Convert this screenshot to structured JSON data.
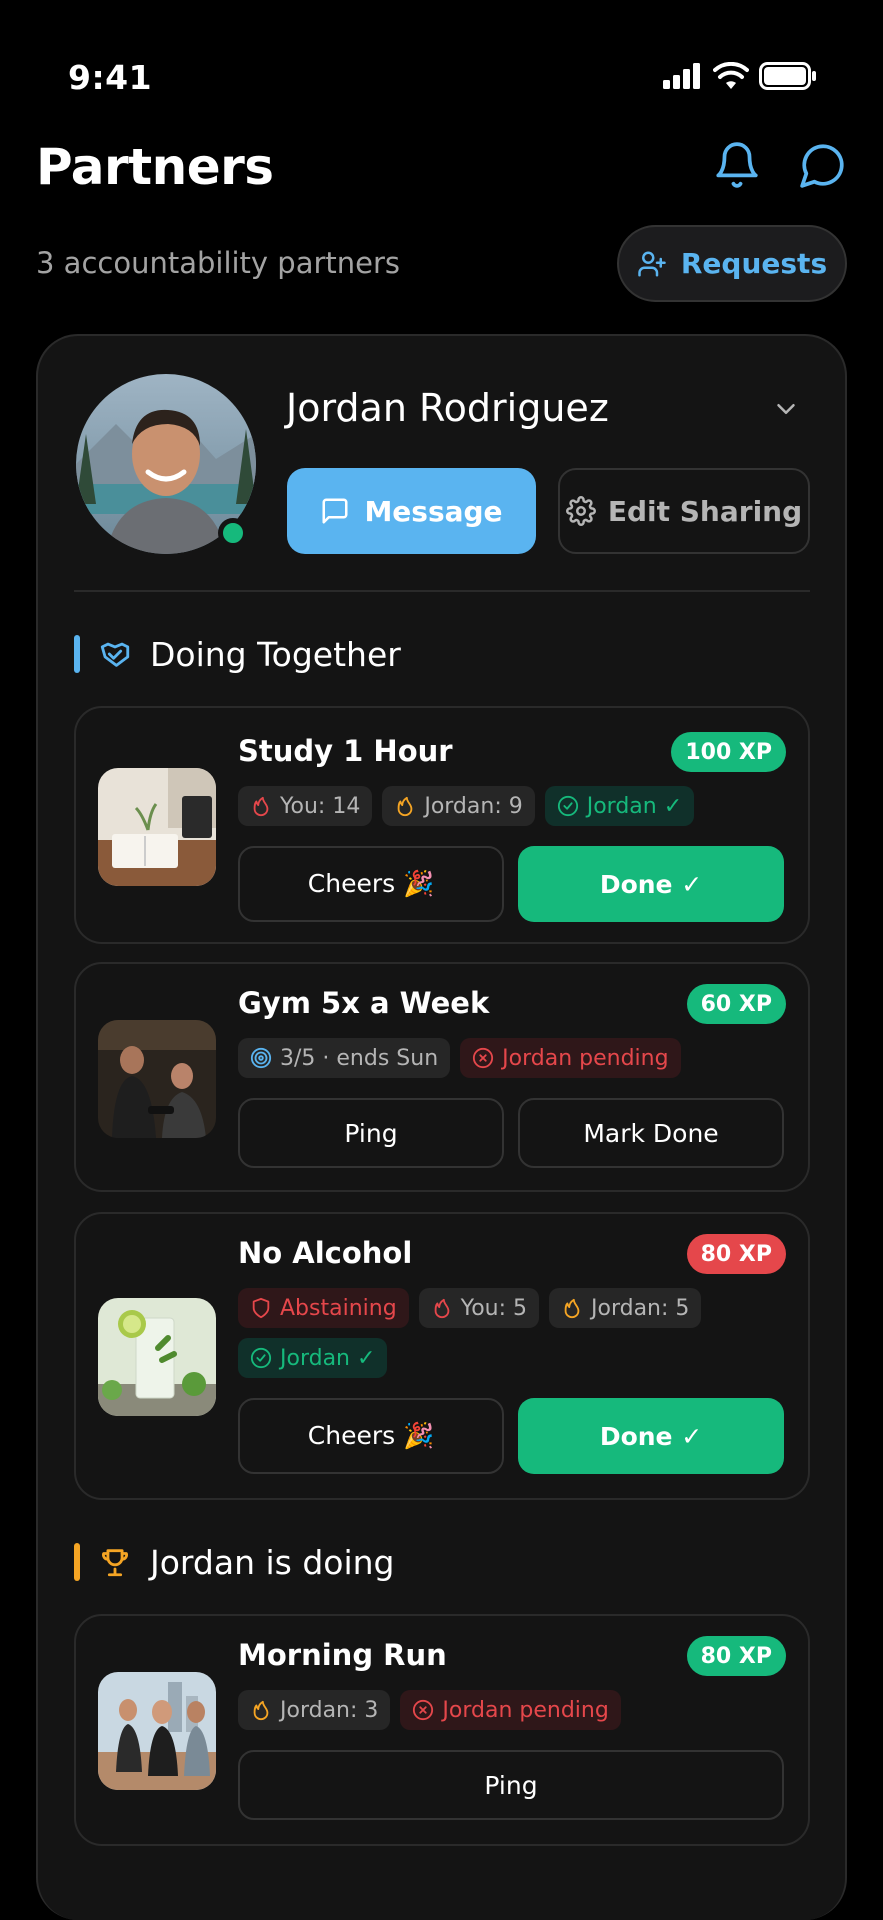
{
  "status_bar": {
    "time": "9:41"
  },
  "header": {
    "title": "Partners",
    "subtitle": "3 accountability partners",
    "requests_label": "Requests"
  },
  "partner": {
    "name": "Jordan Rodriguez",
    "message_label": "Message",
    "edit_sharing_label": "Edit Sharing",
    "online": true
  },
  "sections": {
    "together_label": "Doing Together",
    "partner_doing_label": "Jordan is doing"
  },
  "tasks": [
    {
      "title": "Study 1 Hour",
      "xp": "100 XP",
      "chips": [
        "You: 14",
        "Jordan: 9",
        "Jordan ✓"
      ],
      "buttons": [
        "Cheers 🎉",
        "Done ✓"
      ]
    },
    {
      "title": "Gym 5x a Week",
      "xp": "60 XP",
      "chips": [
        "3/5 · ends Sun",
        "Jordan pending"
      ],
      "buttons": [
        "Ping",
        "Mark Done"
      ]
    },
    {
      "title": "No Alcohol",
      "xp": "80 XP",
      "chips": [
        "Abstaining",
        "You: 5",
        "Jordan: 5",
        "Jordan ✓"
      ],
      "buttons": [
        "Cheers 🎉",
        "Done ✓"
      ]
    },
    {
      "title": "Morning Run",
      "xp": "80 XP",
      "chips": [
        "Jordan: 3",
        "Jordan pending"
      ],
      "buttons": [
        "Ping"
      ]
    }
  ],
  "colors": {
    "accent": "#5ab4f0",
    "success": "#16b97c",
    "danger": "#e5474b",
    "warning": "#f5a524"
  }
}
